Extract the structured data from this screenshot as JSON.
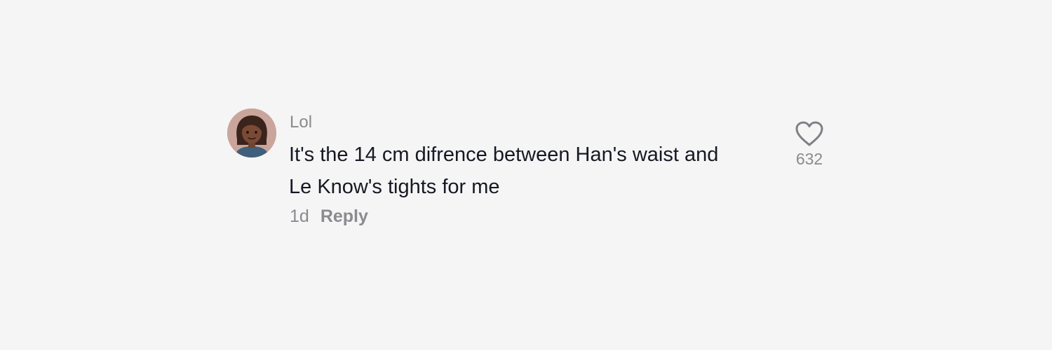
{
  "comment": {
    "avatar_icon": "user-avatar-icon",
    "username": "Lol",
    "text_line1": "It's the 14 cm difrence between Han's waist and",
    "text_line2": "Le Know's tights for me",
    "time": "1d",
    "reply_label": "Reply",
    "like_icon": "heart-outline-icon",
    "like_count": "632"
  }
}
